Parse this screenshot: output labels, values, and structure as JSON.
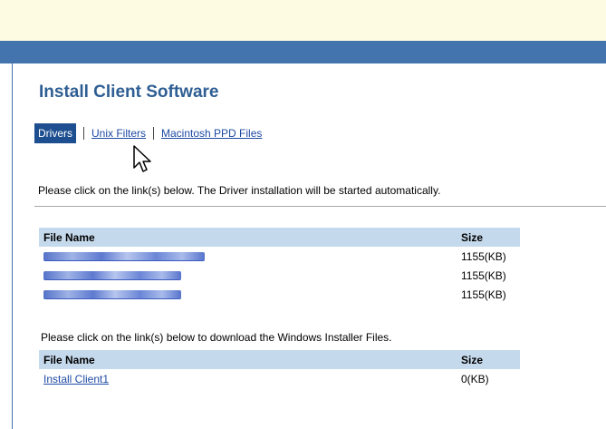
{
  "page": {
    "title": "Install Client Software"
  },
  "tabs": [
    {
      "label": "Drivers",
      "active": true
    },
    {
      "label": "Unix Filters",
      "active": false
    },
    {
      "label": "Macintosh PPD Files",
      "active": false
    }
  ],
  "drivers": {
    "instruction": "Please click on the link(s) below. The Driver installation will be started automatically.",
    "columns": [
      "File Name",
      "Size"
    ],
    "rows": [
      {
        "name": "",
        "size": "1155(KB)"
      },
      {
        "name": "",
        "size": "1155(KB)"
      },
      {
        "name": "",
        "size": "1155(KB)"
      }
    ]
  },
  "installer": {
    "instruction": "Please click on the link(s) below to download the Windows Installer Files.",
    "columns": [
      "File Name",
      "Size"
    ],
    "rows": [
      {
        "name": "Install Client1",
        "size": "0(KB)"
      }
    ]
  },
  "colors": {
    "header_band": "#4474ad",
    "top_band": "#fdfbe1",
    "table_header": "#c5d9ec",
    "link": "#1f4aa3",
    "title": "#2e5e93"
  },
  "icons": {
    "cursor": "mouse-pointer-icon"
  }
}
